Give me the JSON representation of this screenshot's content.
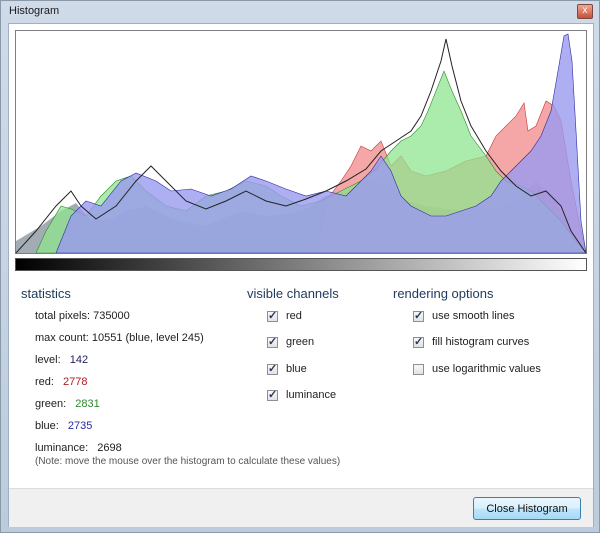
{
  "window": {
    "title": "Histogram",
    "close_glyph": "x"
  },
  "colors": {
    "red": "#f28a8a",
    "green": "#8fe48f",
    "blue": "#9a9af0",
    "luminance": "#9aa3ab",
    "olive": "#b4b57a",
    "purple": "#b07fcc",
    "teal": "#7aa8b8"
  },
  "statistics": {
    "title": "statistics",
    "total_pixels": "total pixels: 735000",
    "max_count": "max count: 10551 (blue, level 245)",
    "level_label": "level:",
    "level_value": "142",
    "red_label": "red:",
    "red_value": "2778",
    "green_label": "green:",
    "green_value": "2831",
    "blue_label": "blue:",
    "blue_value": "2735",
    "luminance_label": "luminance:",
    "luminance_value": "2698",
    "note": "(Note: move the mouse over the histogram to calculate these values)"
  },
  "visible_channels": {
    "title": "visible channels",
    "items": [
      {
        "label": "red",
        "checked": true
      },
      {
        "label": "green",
        "checked": true
      },
      {
        "label": "blue",
        "checked": true
      },
      {
        "label": "luminance",
        "checked": true
      }
    ]
  },
  "rendering_options": {
    "title": "rendering options",
    "items": [
      {
        "label": "use smooth lines",
        "checked": true
      },
      {
        "label": "fill histogram curves",
        "checked": true
      },
      {
        "label": "use logarithmic values",
        "checked": false
      }
    ]
  },
  "footer": {
    "close_button": "Close Histogram"
  }
}
